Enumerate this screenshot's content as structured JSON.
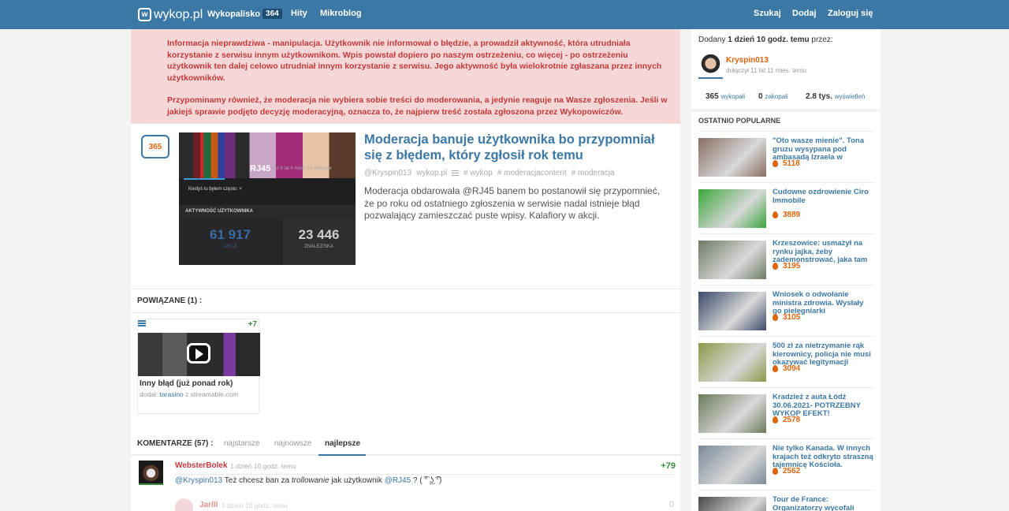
{
  "topbar": {
    "logo": "wykop.pl",
    "nav": [
      {
        "label": "Wykopalisko",
        "badge": "364"
      },
      {
        "label": "Hity"
      },
      {
        "label": "Mikroblog"
      }
    ],
    "right": [
      "Szukaj",
      "Dodaj",
      "Zaloguj się"
    ]
  },
  "alert": {
    "p1": "Informacja nieprawdziwa - manipulacja. Użytkownik nie informował o błędzie, a prowadził aktywność, która utrudniała korzystanie z serwisu innym użytkownikom. Wpis powstał dopiero po naszym ostrzeżeniu, co więcej - po ostrzeżeniu użytkownik ten dalej celowo utrudniał innym korzystanie z serwisu. Jego aktywność była wielokrotnie zgłaszana przez innych użytkowników.",
    "p2": "Przypominamy również, że moderacja nie wybiera sobie treści do moderowania, a jedynie reaguje na Wasze zgłoszenia. Jeśli w jakiejś sprawie podjęto decyzję moderacyjną, oznacza to, że najpierw treść została zgłoszona przez Wykopowiczów."
  },
  "article": {
    "votes": "365",
    "title": "Moderacja banuje użytkownika bo przypomniał się z błędem, który zgłosił rok temu",
    "author": "@Kryspin013",
    "domain": "wykop.pl",
    "tags": [
      "# wykop",
      "# moderacjacontent",
      "# moderacja"
    ],
    "description": "Moderacja obdarowała @RJ45 banem bo postanowił się przypomnieć, że po roku od ostatniego zgłoszenia w serwisie nadal istnieje błąd pozwalający zamieszczać puste wpisy. Kalafiory w akcji.",
    "thumb": {
      "name": "RJ45",
      "sub": "od 6 lat 4 mies. na Wykopie",
      "cz": "Kiedyś tu byłem często :<",
      "activity": "AKTYWNOŚĆ UŻYTKOWNIKA",
      "stat1": "61 917",
      "stat1_label": "AKCJI",
      "stat2": "23 446",
      "stat2_label": "ZNALEZISKA"
    }
  },
  "related": {
    "heading": "POWIĄZANE (1) :",
    "card": {
      "plus": "+7",
      "title": "Inny błąd (już ponad rok)",
      "added_prefix": "dodał:",
      "user": "tarasino",
      "source": "z streamable.com"
    }
  },
  "comments": {
    "heading": "KOMENTARZE (57) :",
    "tabs": [
      "najstarsze",
      "najnowsze",
      "najlepsze"
    ],
    "first": {
      "author": "WebsterBolek",
      "time": "1 dzień 10 godz. temu",
      "votes": "+79",
      "mention1": "@Kryspin013",
      "text_a": " Też chcesz ban za ",
      "text_em": "trollowanie",
      "text_b": " jak użytkownik ",
      "mention2": "@RJ45",
      "text_c": " ? ( ͡° ͜ʖ ͡°)"
    },
    "second": {
      "author": "Jarlll",
      "time": "1 dzień 10 godz. temu",
      "votes": "0"
    }
  },
  "sidebar": {
    "added_prefix": "Dodany",
    "added_time": "1 dzień 10 godz. temu",
    "added_suffix": "przez:",
    "author": "Kryspin013",
    "joined": "dołączył 11 lat 11 mies. temu",
    "stats": [
      {
        "value": "365",
        "label": "wykopali"
      },
      {
        "value": "0",
        "label": "zakopali"
      },
      {
        "value": "2.8 tys.",
        "label": "wyświetleń"
      }
    ],
    "popular_heading": "OSTATNIO POPULARNE",
    "popular": [
      {
        "title": "\"Oto wasze mienie\". Tona gruzu wysypana pod ambasadą Izraela w",
        "score": "5118",
        "color": "#8a6e62"
      },
      {
        "title": "Cudowne ozdrowienie Ciro Immobile",
        "score": "3889",
        "color": "#3aa53a"
      },
      {
        "title": "Krzeszowice: usmażył na rynku jajka, żeby zademonstrować, jaka tam",
        "score": "3195",
        "color": "#6c7a62"
      },
      {
        "title": "Wniosek o odwołanie ministra zdrowia. Wysłały go pielęgniarki",
        "score": "3105",
        "color": "#3a4a6a"
      },
      {
        "title": "500 zł za nietrzymanie rąk kierownicy, policja nie musi okazywać legitymacji",
        "score": "3094",
        "color": "#8b9a4a"
      },
      {
        "title": "Kradzież z auta Łódź 30.06.2021- POTRZEBNY WYKOP EFEKT!",
        "score": "2578",
        "color": "#6a7a5a"
      },
      {
        "title": "Nie tylko Kanada. W innych krajach też odkryto straszną tajemnicę Kościoła.",
        "score": "2562",
        "color": "#7a8a9a"
      },
      {
        "title": "Tour de France: Organizatorzy wycofali",
        "score": "",
        "color": "#4a4a4a"
      }
    ]
  }
}
